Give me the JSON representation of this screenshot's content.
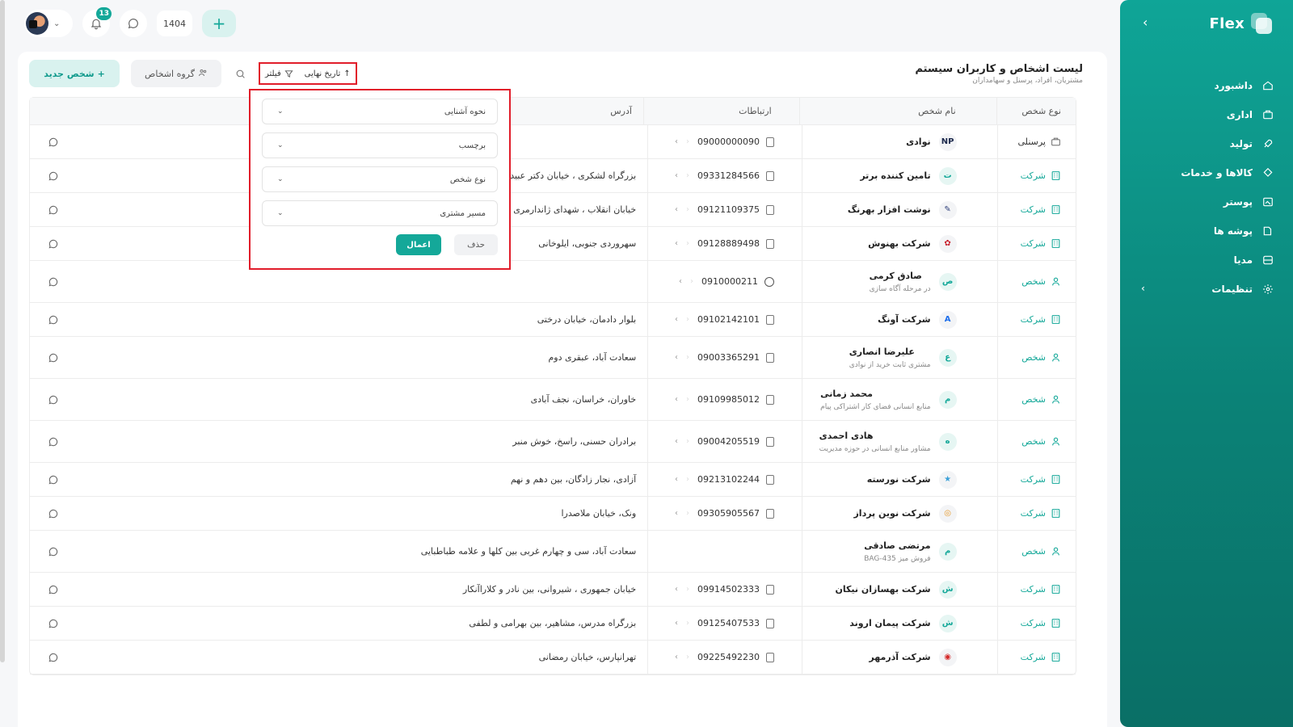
{
  "topbar": {
    "notification_count": "13",
    "year": "1404",
    "plus_label": "+"
  },
  "sidebar": {
    "logo_text": "Flex",
    "items": [
      {
        "label": "داشبورد",
        "icon": "home-icon"
      },
      {
        "label": "اداری",
        "icon": "briefcase-icon"
      },
      {
        "label": "تولید",
        "icon": "rocket-icon"
      },
      {
        "label": "کالاها و خدمات",
        "icon": "box-icon"
      },
      {
        "label": "پوستر",
        "icon": "image-icon"
      },
      {
        "label": "پوشه ها",
        "icon": "folder-icon"
      },
      {
        "label": "مدیا",
        "icon": "globe-icon"
      },
      {
        "label": "تنظیمات",
        "icon": "gear-icon"
      }
    ]
  },
  "page": {
    "title": "لیست اشخاص و کاربران سیستم",
    "subtitle": "مشتریان، افراد، پرسنل و سهامداران"
  },
  "toolbar": {
    "new_person": "شخص جدید",
    "group_persons": "گروه اشخاص",
    "filter": "فیلتر",
    "sort": "تاریخ نهایی"
  },
  "filter_popup": {
    "fields": [
      "نحوه آشنایی",
      "برچسب",
      "نوع شخص",
      "مسیر مشتری"
    ],
    "apply": "اعمال",
    "clear": "حذف"
  },
  "table": {
    "headers": {
      "type": "نوع شخص",
      "name": "نام شخص",
      "contact": "ارتباطات",
      "address": "آدرس"
    },
    "rows": [
      {
        "type": "پرسنلی",
        "kind": "staff",
        "name": "نوادی",
        "sub": "",
        "logo": "NP",
        "logo_color": "#1d2a4d",
        "phone": "09000000090",
        "phone_kind": "mobile",
        "address": ""
      },
      {
        "type": "شرکت",
        "kind": "company",
        "name": "تامین کننده برتر",
        "sub": "",
        "logo": "ت",
        "logo_color": "",
        "phone": "09331284566",
        "phone_kind": "mobile",
        "address": "بزرگراه لشکری ، خیابان دکتر عبید"
      },
      {
        "type": "شرکت",
        "kind": "company",
        "name": "نوشت افزار بهرنگ",
        "sub": "",
        "logo": "✎",
        "logo_color": "#2d3f7a",
        "phone": "09121109375",
        "phone_kind": "mobile",
        "address": "خیابان انقلاب ، شهدای ژاندارمری"
      },
      {
        "type": "شرکت",
        "kind": "company",
        "name": "شرکت بهنوش",
        "sub": "",
        "logo": "✿",
        "logo_color": "#c8202d",
        "phone": "09128889498",
        "phone_kind": "mobile",
        "address": "سهروردی جنوبی، ایلوخانی"
      },
      {
        "type": "شخص",
        "kind": "person",
        "name": "صادق کرمی",
        "sub": "در مرحله آگاه سازی",
        "logo": "ص",
        "logo_color": "",
        "phone": "0910000211",
        "phone_kind": "whatsapp",
        "address": ""
      },
      {
        "type": "شرکت",
        "kind": "company",
        "name": "شرکت آونگ",
        "sub": "",
        "logo": "A",
        "logo_color": "#1f6feb",
        "phone": "09102142101",
        "phone_kind": "mobile",
        "address": "بلوار دادمان، خیابان درختی"
      },
      {
        "type": "شخص",
        "kind": "person",
        "name": "علیرضا انصاری",
        "sub": "مشتری ثابت خرید از نوادی",
        "logo": "ع",
        "logo_color": "",
        "phone": "09003365291",
        "phone_kind": "mobile",
        "address": "سعادت آباد، عبقری دوم"
      },
      {
        "type": "شخص",
        "kind": "person",
        "name": "محمد زمانی",
        "sub": "منابع انسانی فضای کار اشتراکی پیام",
        "logo": "م",
        "logo_color": "",
        "phone": "09109985012",
        "phone_kind": "mobile",
        "address": "خاوران، خراسان، نجف آبادی"
      },
      {
        "type": "شخص",
        "kind": "person",
        "name": "هادی احمدی",
        "sub": "مشاور منابع انسانی در حوزه مدیریت",
        "logo": "ه",
        "logo_color": "",
        "phone": "09004205519",
        "phone_kind": "mobile",
        "address": "برادران حسنی، راسخ، خوش منبر"
      },
      {
        "type": "شرکت",
        "kind": "company",
        "name": "شرکت نورسته",
        "sub": "",
        "logo": "★",
        "logo_color": "#3aa0d8",
        "phone": "09213102244",
        "phone_kind": "mobile",
        "address": "آزادی، نجار زادگان، بین دهم و نهم"
      },
      {
        "type": "شرکت",
        "kind": "company",
        "name": "شرکت نوین پرداز",
        "sub": "",
        "logo": "◎",
        "logo_color": "#e79a2b",
        "phone": "09305905567",
        "phone_kind": "mobile",
        "address": "ونک، خیابان ملاصدرا"
      },
      {
        "type": "شخص",
        "kind": "person",
        "name": "مرتضی صادقی",
        "sub": "فروش میز BAG-435",
        "logo": "م",
        "logo_color": "",
        "phone": "",
        "phone_kind": "",
        "address": "سعادت آباد، سی و چهارم غربی بین کلها و علامه طباطبایی"
      },
      {
        "type": "شرکت",
        "kind": "company",
        "name": "شرکت بهسازان نیکان",
        "sub": "",
        "logo": "ش",
        "logo_color": "",
        "phone": "09914502333",
        "phone_kind": "mobile",
        "address": "خیابان جمهوری ، شیروانی، بین نادر و کلاراآنکار"
      },
      {
        "type": "شرکت",
        "kind": "company",
        "name": "شرکت پیمان اروند",
        "sub": "",
        "logo": "ش",
        "logo_color": "",
        "phone": "09125407533",
        "phone_kind": "mobile",
        "address": "بزرگراه مدرس، مشاهیر، بین بهرامی و لطفی"
      },
      {
        "type": "شرکت",
        "kind": "company",
        "name": "شرکت آذرمهر",
        "sub": "",
        "logo": "◉",
        "logo_color": "#d42a2a",
        "phone": "09225492230",
        "phone_kind": "mobile",
        "address": "تهرانپارس، خیابان رمضانی"
      }
    ]
  },
  "colors": {
    "accent": "#14a899",
    "highlight": "#e11d2a"
  }
}
